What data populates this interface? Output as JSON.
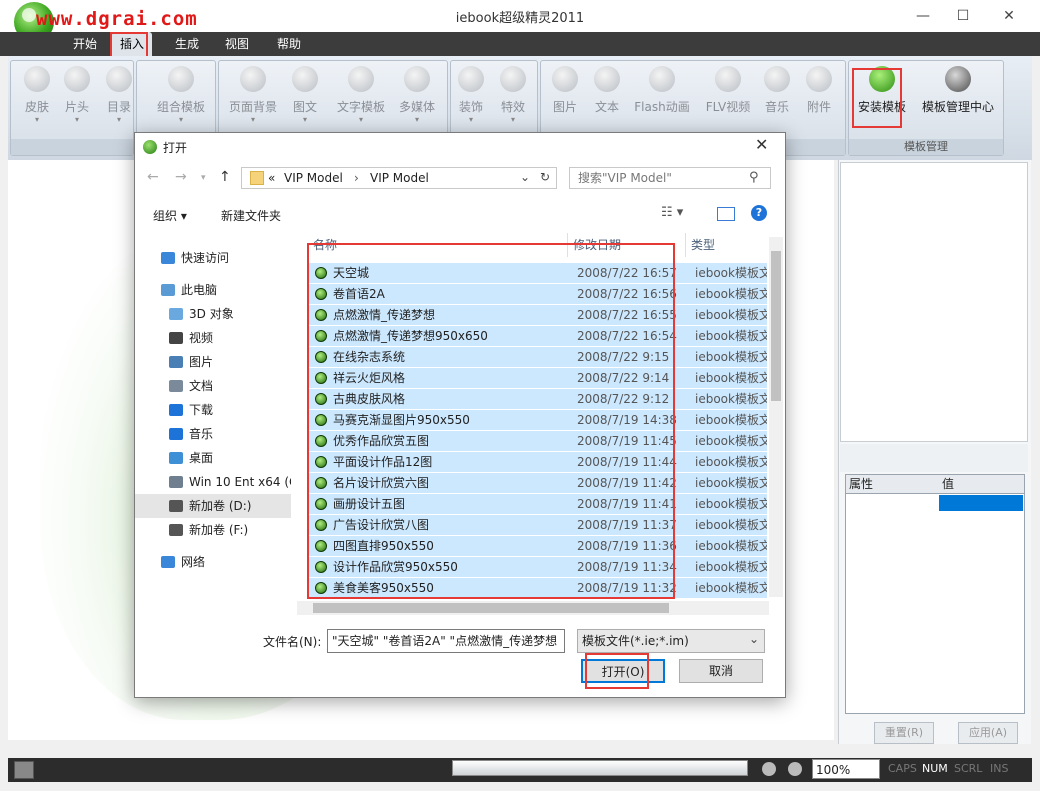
{
  "app": {
    "title": "iebook超级精灵2011",
    "watermark": "www.dgrai.com",
    "window_controls": [
      "—",
      "☐",
      "✕"
    ]
  },
  "menu": [
    "开始",
    "插入",
    "生成",
    "视图",
    "帮助"
  ],
  "ribbon": {
    "buttons": [
      "皮肤",
      "片头",
      "目录",
      "组合模板",
      "页面背景",
      "图文",
      "文字模板",
      "多媒体",
      "装饰",
      "特效",
      "图片",
      "文本",
      "Flash动画",
      "FLV视频",
      "音乐",
      "附件"
    ],
    "template_group": {
      "label": "模板管理",
      "install": "安装模板",
      "manager": "模板管理中心"
    }
  },
  "dialog": {
    "title": "打开",
    "address": [
      "VIP Model",
      "VIP Model"
    ],
    "address_sep": "«",
    "search_placeholder": "搜索\"VIP Model\"",
    "organize": "组织 ▾",
    "new_folder": "新建文件夹",
    "nav": [
      {
        "label": "快速访问",
        "color": "#3a86d9"
      },
      {
        "label": "此电脑",
        "color": "#5b9bd5"
      },
      {
        "label": "3D 对象",
        "color": "#6aa9e0"
      },
      {
        "label": "视频",
        "color": "#444444"
      },
      {
        "label": "图片",
        "color": "#4a7fb5"
      },
      {
        "label": "文档",
        "color": "#7a8a9a"
      },
      {
        "label": "下载",
        "color": "#1e73d8"
      },
      {
        "label": "音乐",
        "color": "#1e73d8"
      },
      {
        "label": "桌面",
        "color": "#3d8fd6"
      },
      {
        "label": "Win 10 Ent x64 (C",
        "color": "#6f7f8f"
      },
      {
        "label": "新加卷 (D:)",
        "color": "#555555"
      },
      {
        "label": "新加卷 (F:)",
        "color": "#555555"
      },
      {
        "label": "网络",
        "color": "#3a86d9"
      }
    ],
    "columns": {
      "name": "名称",
      "date": "修改日期",
      "type": "类型"
    },
    "files": [
      {
        "name": "天空城",
        "date": "2008/7/22 16:57",
        "type": "iebook模板文"
      },
      {
        "name": "卷首语2A",
        "date": "2008/7/22 16:56",
        "type": "iebook模板文"
      },
      {
        "name": "点燃激情_传递梦想",
        "date": "2008/7/22 16:55",
        "type": "iebook模板文"
      },
      {
        "name": "点燃激情_传递梦想950x650",
        "date": "2008/7/22 16:54",
        "type": "iebook模板文"
      },
      {
        "name": "在线杂志系统",
        "date": "2008/7/22 9:15",
        "type": "iebook模板文"
      },
      {
        "name": "祥云火炬风格",
        "date": "2008/7/22 9:14",
        "type": "iebook模板文"
      },
      {
        "name": "古典皮肤风格",
        "date": "2008/7/22 9:12",
        "type": "iebook模板文"
      },
      {
        "name": "马赛克渐显图片950x550",
        "date": "2008/7/19 14:38",
        "type": "iebook模板文"
      },
      {
        "name": "优秀作品欣赏五图",
        "date": "2008/7/19 11:45",
        "type": "iebook模板文"
      },
      {
        "name": "平面设计作品12图",
        "date": "2008/7/19 11:44",
        "type": "iebook模板文"
      },
      {
        "name": "名片设计欣赏六图",
        "date": "2008/7/19 11:42",
        "type": "iebook模板文"
      },
      {
        "name": "画册设计五图",
        "date": "2008/7/19 11:41",
        "type": "iebook模板文"
      },
      {
        "name": "广告设计欣赏八图",
        "date": "2008/7/19 11:37",
        "type": "iebook模板文"
      },
      {
        "name": "四图直排950x550",
        "date": "2008/7/19 11:36",
        "type": "iebook模板文"
      },
      {
        "name": "设计作品欣赏950x550",
        "date": "2008/7/19 11:34",
        "type": "iebook模板文"
      },
      {
        "name": "美食美客950x550",
        "date": "2008/7/19 11:32",
        "type": "iebook模板文"
      }
    ],
    "filename_label": "文件名(N):",
    "filename_value": "\"天空城\" \"卷首语2A\" \"点燃激情_传递梦想",
    "filter": "模板文件(*.ie;*.im)",
    "open_btn": "打开(O)",
    "cancel_btn": "取消"
  },
  "props": {
    "col_attr": "属性",
    "col_val": "值",
    "reset": "重置(R)",
    "apply": "应用(A)",
    "value_color": "#0078d7"
  },
  "status": {
    "zoom": "100%",
    "indicators": [
      "CAPS",
      "NUM",
      "SCRL",
      "INS"
    ]
  },
  "colors": {
    "selection": "#cce8ff",
    "highlight_red": "#e53935",
    "accent": "#0078d7"
  }
}
